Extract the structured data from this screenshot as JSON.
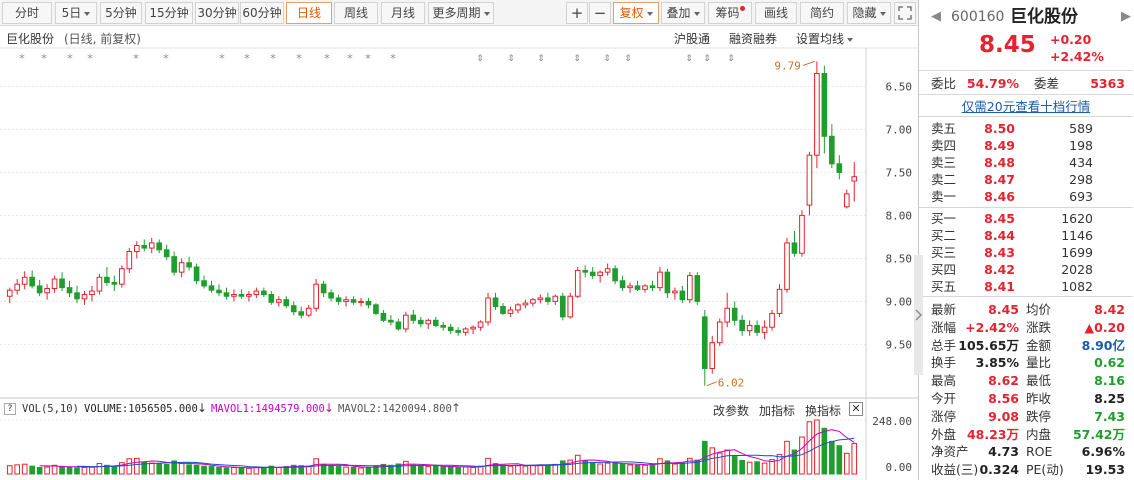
{
  "toolbar": {
    "fenshi": "分时",
    "five_day": "5日",
    "min5": "5分钟",
    "min15": "15分钟",
    "min30": "30分钟",
    "min60": "60分钟",
    "daily": "日线",
    "weekly": "周线",
    "monthly": "月线",
    "more": "更多周期",
    "plus": "+",
    "minus": "−",
    "adjust": "复权",
    "overlay": "叠加",
    "chips": "筹码",
    "draw": "画线",
    "simple": "简约",
    "hide": "隐藏"
  },
  "chart": {
    "title": "巨化股份",
    "subtitle": "(日线, 前复权)",
    "links": {
      "hgt": "沪股通",
      "margin": "融资融券",
      "ma_settings": "设置均线"
    },
    "price_axis": [
      "9.50",
      "9.00",
      "8.50",
      "8.00",
      "7.50",
      "7.00",
      "6.50"
    ],
    "annotations": {
      "high": "9.79",
      "low": "6.02"
    },
    "volume": {
      "label": "VOL(5,10)",
      "volume_text": "VOLUME:1056505.000",
      "mavol1_text": "MAVOL1:1494579.000",
      "mavol2_text": "MAVOL2:1420094.800",
      "edit_params": "改参数",
      "add_indicator": "加指标",
      "switch_indicator": "换指标",
      "axis": [
        "248.00",
        "0.00"
      ]
    },
    "colors": {
      "up": "#e4232f",
      "down": "#1f9e2e",
      "ma5": "#c800c8",
      "ma10": "#1e50c8",
      "grid": "#e8e8e8"
    }
  },
  "chart_data": {
    "type": "candlestick",
    "ylim": [
      5.9,
      9.9
    ],
    "yticks": [
      6.5,
      7.0,
      7.5,
      8.0,
      8.5,
      9.0,
      9.5
    ],
    "ohlc": [
      [
        7.06,
        7.16,
        6.98,
        7.13
      ],
      [
        7.13,
        7.26,
        7.08,
        7.2
      ],
      [
        7.2,
        7.35,
        7.14,
        7.28
      ],
      [
        7.28,
        7.36,
        7.15,
        7.18
      ],
      [
        7.18,
        7.25,
        7.06,
        7.1
      ],
      [
        7.1,
        7.2,
        7.02,
        7.15
      ],
      [
        7.15,
        7.3,
        7.1,
        7.26
      ],
      [
        7.26,
        7.34,
        7.12,
        7.16
      ],
      [
        7.16,
        7.24,
        7.05,
        7.1
      ],
      [
        7.1,
        7.18,
        6.98,
        7.03
      ],
      [
        7.03,
        7.12,
        6.96,
        7.08
      ],
      [
        7.08,
        7.18,
        7.0,
        7.12
      ],
      [
        7.12,
        7.32,
        7.08,
        7.28
      ],
      [
        7.28,
        7.4,
        7.18,
        7.22
      ],
      [
        7.22,
        7.3,
        7.12,
        7.2
      ],
      [
        7.2,
        7.42,
        7.16,
        7.38
      ],
      [
        7.38,
        7.62,
        7.33,
        7.58
      ],
      [
        7.58,
        7.7,
        7.5,
        7.65
      ],
      [
        7.65,
        7.72,
        7.58,
        7.62
      ],
      [
        7.62,
        7.74,
        7.56,
        7.68
      ],
      [
        7.68,
        7.72,
        7.56,
        7.6
      ],
      [
        7.6,
        7.66,
        7.48,
        7.52
      ],
      [
        7.52,
        7.58,
        7.3,
        7.34
      ],
      [
        7.34,
        7.5,
        7.28,
        7.45
      ],
      [
        7.45,
        7.52,
        7.36,
        7.4
      ],
      [
        7.4,
        7.44,
        7.2,
        7.24
      ],
      [
        7.24,
        7.3,
        7.15,
        7.18
      ],
      [
        7.18,
        7.24,
        7.1,
        7.13
      ],
      [
        7.13,
        7.2,
        7.06,
        7.1
      ],
      [
        7.1,
        7.16,
        7.02,
        7.06
      ],
      [
        7.06,
        7.14,
        7.0,
        7.08
      ],
      [
        7.08,
        7.14,
        7.03,
        7.06
      ],
      [
        7.06,
        7.12,
        7.0,
        7.08
      ],
      [
        7.08,
        7.16,
        7.04,
        7.12
      ],
      [
        7.12,
        7.16,
        7.05,
        7.08
      ],
      [
        7.08,
        7.12,
        6.96,
        6.99
      ],
      [
        6.99,
        7.06,
        6.94,
        7.02
      ],
      [
        7.02,
        7.06,
        6.92,
        6.95
      ],
      [
        6.95,
        7.0,
        6.84,
        6.88
      ],
      [
        6.88,
        6.94,
        6.8,
        6.84
      ],
      [
        6.84,
        6.96,
        6.82,
        6.92
      ],
      [
        6.92,
        7.26,
        6.88,
        7.2
      ],
      [
        7.2,
        7.24,
        7.05,
        7.1
      ],
      [
        7.1,
        7.14,
        7.0,
        7.04
      ],
      [
        7.04,
        7.08,
        6.96,
        7.0
      ],
      [
        7.0,
        7.06,
        6.94,
        7.02
      ],
      [
        7.02,
        7.06,
        6.96,
        6.99
      ],
      [
        6.99,
        7.04,
        6.94,
        7.0
      ],
      [
        7.0,
        7.04,
        6.92,
        6.96
      ],
      [
        6.96,
        6.98,
        6.84,
        6.86
      ],
      [
        6.86,
        6.9,
        6.76,
        6.78
      ],
      [
        6.78,
        6.84,
        6.72,
        6.76
      ],
      [
        6.76,
        6.8,
        6.66,
        6.68
      ],
      [
        6.68,
        6.88,
        6.64,
        6.84
      ],
      [
        6.84,
        6.9,
        6.74,
        6.78
      ],
      [
        6.78,
        6.82,
        6.7,
        6.74
      ],
      [
        6.74,
        6.8,
        6.68,
        6.78
      ],
      [
        6.78,
        6.82,
        6.7,
        6.72
      ],
      [
        6.72,
        6.76,
        6.66,
        6.7
      ],
      [
        6.7,
        6.74,
        6.62,
        6.66
      ],
      [
        6.66,
        6.7,
        6.6,
        6.64
      ],
      [
        6.64,
        6.7,
        6.6,
        6.68
      ],
      [
        6.68,
        6.72,
        6.62,
        6.7
      ],
      [
        6.7,
        6.78,
        6.66,
        6.76
      ],
      [
        6.76,
        7.1,
        6.72,
        7.04
      ],
      [
        7.04,
        7.1,
        6.9,
        6.94
      ],
      [
        6.94,
        6.98,
        6.84,
        6.86
      ],
      [
        6.86,
        6.94,
        6.82,
        6.9
      ],
      [
        6.9,
        6.98,
        6.86,
        6.96
      ],
      [
        6.96,
        7.02,
        6.92,
        6.98
      ],
      [
        6.98,
        7.04,
        6.94,
        7.02
      ],
      [
        7.02,
        7.08,
        6.98,
        7.04
      ],
      [
        7.04,
        7.1,
        6.96,
        7.0
      ],
      [
        7.0,
        7.08,
        6.96,
        7.06
      ],
      [
        7.06,
        7.1,
        6.78,
        6.82
      ],
      [
        6.82,
        7.1,
        6.8,
        7.06
      ],
      [
        7.06,
        7.4,
        7.04,
        7.36
      ],
      [
        7.36,
        7.42,
        7.28,
        7.34
      ],
      [
        7.34,
        7.4,
        7.26,
        7.3
      ],
      [
        7.3,
        7.36,
        7.22,
        7.34
      ],
      [
        7.34,
        7.44,
        7.3,
        7.38
      ],
      [
        7.38,
        7.42,
        7.2,
        7.24
      ],
      [
        7.24,
        7.3,
        7.12,
        7.16
      ],
      [
        7.16,
        7.22,
        7.1,
        7.18
      ],
      [
        7.18,
        7.24,
        7.12,
        7.14
      ],
      [
        7.14,
        7.2,
        7.1,
        7.18
      ],
      [
        7.18,
        7.24,
        7.12,
        7.16
      ],
      [
        7.16,
        7.4,
        7.12,
        7.34
      ],
      [
        7.34,
        7.38,
        7.04,
        7.1
      ],
      [
        7.1,
        7.16,
        7.02,
        7.12
      ],
      [
        7.12,
        7.18,
        6.98,
        7.02
      ],
      [
        7.02,
        7.34,
        6.98,
        7.3
      ],
      [
        7.3,
        7.34,
        6.96,
        7.0
      ],
      [
        6.82,
        6.9,
        6.02,
        6.22
      ],
      [
        6.22,
        6.6,
        6.16,
        6.52
      ],
      [
        6.52,
        6.8,
        6.48,
        6.76
      ],
      [
        6.76,
        7.1,
        6.7,
        6.92
      ],
      [
        6.92,
        7.0,
        6.72,
        6.78
      ],
      [
        6.78,
        6.84,
        6.6,
        6.66
      ],
      [
        6.66,
        6.78,
        6.6,
        6.72
      ],
      [
        6.72,
        6.78,
        6.6,
        6.64
      ],
      [
        6.64,
        6.78,
        6.56,
        6.7
      ],
      [
        6.7,
        6.9,
        6.66,
        6.86
      ],
      [
        6.86,
        7.2,
        6.82,
        7.14
      ],
      [
        7.14,
        7.74,
        7.1,
        7.68
      ],
      [
        7.68,
        7.82,
        7.52,
        7.56
      ],
      [
        7.56,
        8.06,
        7.52,
        8.0
      ],
      [
        8.12,
        8.74,
        8.0,
        8.7
      ],
      [
        8.7,
        9.79,
        8.55,
        9.65
      ],
      [
        9.65,
        9.74,
        8.72,
        8.92
      ],
      [
        8.92,
        9.06,
        8.55,
        8.6
      ],
      [
        8.6,
        8.7,
        8.42,
        8.5
      ],
      [
        8.1,
        8.3,
        8.08,
        8.25
      ],
      [
        8.4,
        8.62,
        8.16,
        8.45
      ]
    ],
    "volume": [
      38,
      42,
      45,
      36,
      30,
      32,
      40,
      35,
      31,
      28,
      30,
      33,
      48,
      40,
      34,
      52,
      70,
      72,
      55,
      50,
      46,
      44,
      60,
      48,
      42,
      40,
      36,
      34,
      30,
      28,
      30,
      28,
      26,
      32,
      30,
      36,
      30,
      34,
      40,
      38,
      36,
      70,
      44,
      38,
      34,
      32,
      30,
      28,
      30,
      38,
      44,
      40,
      46,
      58,
      40,
      36,
      34,
      36,
      32,
      34,
      30,
      32,
      30,
      36,
      72,
      48,
      40,
      36,
      38,
      36,
      40,
      42,
      40,
      44,
      60,
      64,
      86,
      60,
      52,
      46,
      50,
      48,
      46,
      42,
      40,
      40,
      44,
      70,
      60,
      46,
      50,
      72,
      64,
      150,
      120,
      96,
      110,
      80,
      62,
      54,
      56,
      50,
      66,
      90,
      150,
      110,
      170,
      240,
      248,
      210,
      150,
      130,
      95,
      140
    ],
    "ma_vol5_label": "MAVOL1",
    "ma_vol10_label": "MAVOL2"
  },
  "quote": {
    "code": "600160",
    "name": "巨化股份",
    "price": "8.45",
    "change": "+0.20",
    "change_pct": "+2.42%",
    "weibi_label": "委比",
    "weibi": "54.79%",
    "weicha_label": "委差",
    "weicha": "5363",
    "promo": "仅需20元查看十档行情",
    "asks": [
      {
        "label": "卖五",
        "price": "8.50",
        "vol": "589"
      },
      {
        "label": "卖四",
        "price": "8.49",
        "vol": "198"
      },
      {
        "label": "卖三",
        "price": "8.48",
        "vol": "434"
      },
      {
        "label": "卖二",
        "price": "8.47",
        "vol": "298"
      },
      {
        "label": "卖一",
        "price": "8.46",
        "vol": "693"
      }
    ],
    "bids": [
      {
        "label": "买一",
        "price": "8.45",
        "vol": "1620"
      },
      {
        "label": "买二",
        "price": "8.44",
        "vol": "1146"
      },
      {
        "label": "买三",
        "price": "8.43",
        "vol": "1699"
      },
      {
        "label": "买四",
        "price": "8.42",
        "vol": "2028"
      },
      {
        "label": "买五",
        "price": "8.41",
        "vol": "1082"
      }
    ],
    "stats": [
      {
        "l1": "最新",
        "v1": "8.45",
        "c1": "red",
        "l2": "均价",
        "v2": "8.42",
        "c2": "red"
      },
      {
        "l1": "涨幅",
        "v1": "+2.42%",
        "c1": "red",
        "l2": "涨跌",
        "v2": "▲0.20",
        "c2": "red"
      },
      {
        "l1": "总手",
        "v1": "105.65万",
        "c1": "dark",
        "l2": "金额",
        "v2": "8.90亿",
        "c2": "blue"
      },
      {
        "l1": "换手",
        "v1": "3.85%",
        "c1": "dark",
        "l2": "量比",
        "v2": "0.62",
        "c2": "green"
      },
      {
        "l1": "最高",
        "v1": "8.62",
        "c1": "red",
        "l2": "最低",
        "v2": "8.16",
        "c2": "green"
      },
      {
        "l1": "今开",
        "v1": "8.56",
        "c1": "red",
        "l2": "昨收",
        "v2": "8.25",
        "c2": "dark"
      },
      {
        "l1": "涨停",
        "v1": "9.08",
        "c1": "red",
        "l2": "跌停",
        "v2": "7.43",
        "c2": "green"
      },
      {
        "l1": "外盘",
        "v1": "48.23万",
        "c1": "red",
        "l2": "内盘",
        "v2": "57.42万",
        "c2": "green"
      },
      {
        "l1": "净资产",
        "v1": "4.73",
        "c1": "dark",
        "l2": "ROE",
        "v2": "6.96%",
        "c2": "dark"
      },
      {
        "l1": "收益(三)",
        "v1": "0.324",
        "c1": "dark",
        "l2": "PE(动)",
        "v2": "19.53",
        "c2": "dark"
      }
    ]
  }
}
